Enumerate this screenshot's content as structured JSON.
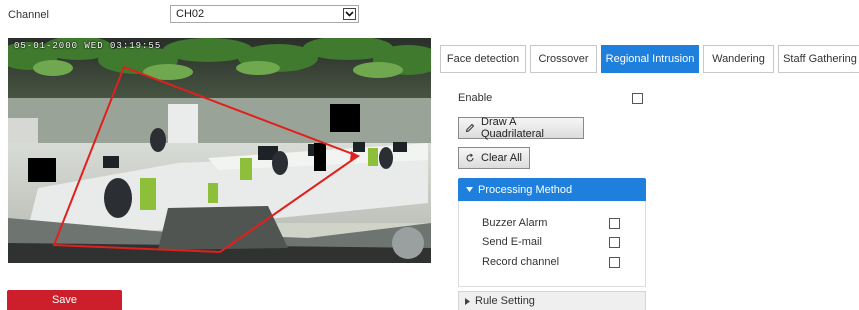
{
  "channel": {
    "label": "Channel",
    "selected": "CH02"
  },
  "video": {
    "osd_timestamp": "05-01-2000 WED 03:19:55"
  },
  "tabs": [
    {
      "label": "Face detection",
      "active": false
    },
    {
      "label": "Crossover",
      "active": false
    },
    {
      "label": "Regional Intrusion",
      "active": true
    },
    {
      "label": "Wandering",
      "active": false
    },
    {
      "label": "Staff Gathering",
      "active": false
    }
  ],
  "enable": {
    "label": "Enable",
    "checked": false
  },
  "buttons": {
    "draw_label": "Draw A Quadrilateral",
    "clear_label": "Clear All",
    "save_label": "Save"
  },
  "processing": {
    "title": "Processing Method",
    "options": [
      {
        "label": "Buzzer Alarm",
        "checked": false
      },
      {
        "label": "Send E-mail",
        "checked": false
      },
      {
        "label": "Record channel",
        "checked": false
      }
    ]
  },
  "rule": {
    "title": "Rule Setting"
  },
  "colors": {
    "accent": "#1e7fdc",
    "save": "#cc1f2b",
    "region_line": "#e0201c"
  },
  "icons": {
    "select_arrow": "chevron-down-icon",
    "draw": "pencil-icon",
    "clear": "refresh-icon",
    "expanded": "triangle-down-icon",
    "collapsed": "triangle-right-icon"
  }
}
